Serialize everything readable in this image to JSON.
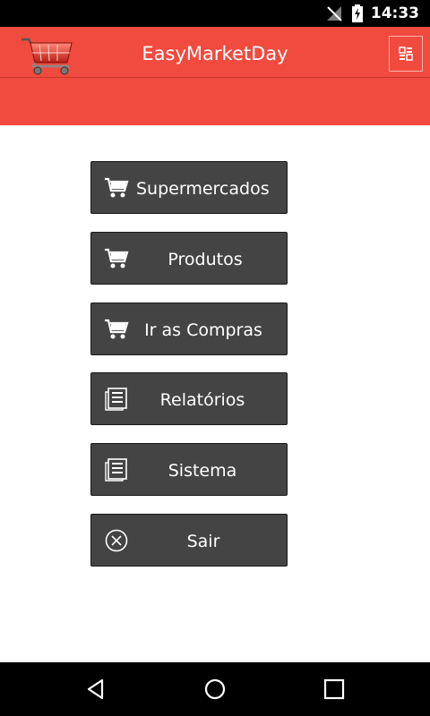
{
  "status_bar": {
    "time": "14:33",
    "icons": [
      "no-signal-icon",
      "battery-charging-icon"
    ]
  },
  "header": {
    "title": "EasyMarketDay",
    "logo": "shopping-cart-logo",
    "menu_icon": "overflow-menu-icon",
    "color": "#f14a3e"
  },
  "menu": {
    "button_color": "#444444",
    "items": [
      {
        "label": "Supermercados",
        "icon": "cart-icon"
      },
      {
        "label": "Produtos",
        "icon": "cart-icon"
      },
      {
        "label": "Ir as Compras",
        "icon": "cart-icon"
      },
      {
        "label": "Relatórios",
        "icon": "report-icon"
      },
      {
        "label": "Sistema",
        "icon": "report-icon"
      },
      {
        "label": "Sair",
        "icon": "close-circle-icon"
      }
    ]
  },
  "nav_bar": {
    "buttons": [
      "back-icon",
      "home-icon",
      "recents-icon"
    ]
  }
}
